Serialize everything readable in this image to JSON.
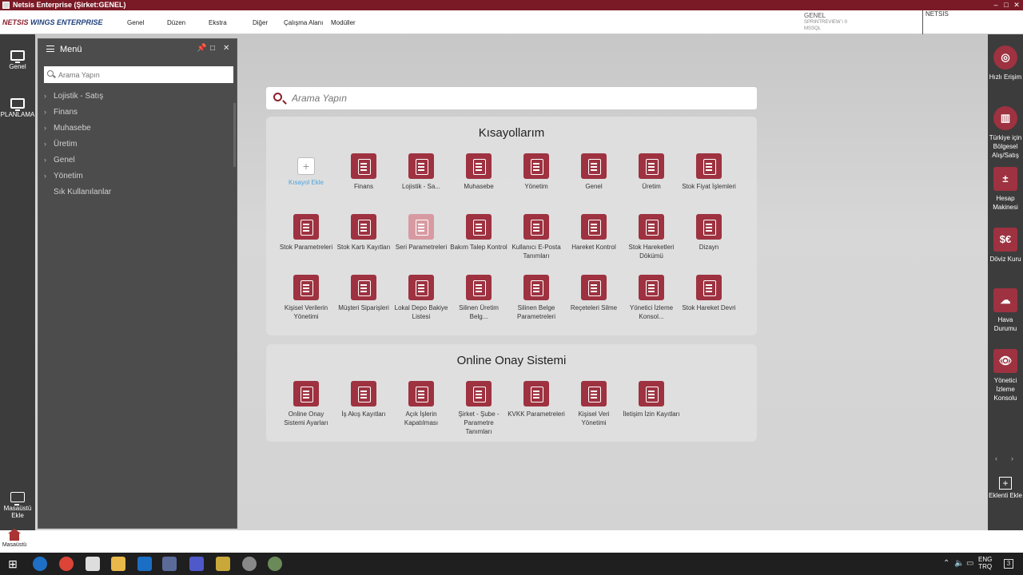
{
  "window": {
    "title": "Netsis Enterprise (Şirket:GENEL)",
    "controls": [
      "–",
      "□",
      "✕"
    ]
  },
  "logo": {
    "prefix": "NETSIS",
    "suffix": "WINGS ENTERPRISE"
  },
  "menubar": [
    "Genel",
    "Düzen",
    "Ekstra",
    "Diğer",
    "Çalışma Alanı",
    "Modüller"
  ],
  "info": {
    "company": "GENEL",
    "line2": "SPRINTREVIEW \\ 0",
    "line3": "MSSQL",
    "product": "NETSIS"
  },
  "left_rail": [
    "Genel",
    "PLANLAMA"
  ],
  "add_desktop": "Masaüstü Ekle",
  "menu_panel": {
    "title": "Menü",
    "search_placeholder": "Arama Yapın",
    "items": [
      "Lojistik - Satış",
      "Finans",
      "Muhasebe",
      "Üretim",
      "Genel",
      "Yönetim",
      "Sık Kullanılanlar"
    ]
  },
  "main_search": {
    "placeholder": "Arama Yapın"
  },
  "shortcuts": {
    "title": "Kısayollarım",
    "add_label": "Kısayol Ekle",
    "items": [
      "Finans",
      "Lojistik - Sa...",
      "Muhasebe",
      "Yönetim",
      "Genel",
      "Üretim",
      "Stok Fiyat İşlemleri",
      "Stok Parametreleri",
      "Stok Kartı Kayıtları",
      "Seri Parametreleri",
      "Bakım Talep Kontrol",
      "Kullanıcı E-Posta Tanımları",
      "Hareket Kontrol",
      "Stok Hareketleri Dökümü",
      "Dizayn",
      "Kişisel Verilerin Yönetimi",
      "Müşteri Siparişleri",
      "Lokal Depo Bakiye Listesi",
      "Silinen Üretim Belg...",
      "Silinen Belge Parametreleri",
      "Reçeteleri Silme",
      "Yönetici İzleme Konsol...",
      "Stok Hareket Devri"
    ]
  },
  "online_approval": {
    "title": "Online Onay Sistemi",
    "items": [
      "Online Onay Sistemi Ayarları",
      "İş Akış Kayıtları",
      "Açık İşlerin Kapatılması",
      "Şirket - Şube - Parametre Tanımları",
      "KVKK Parametreleri",
      "Kişisel Veri Yönetimi",
      "İletişim İzin Kayıtları"
    ]
  },
  "right_rail": [
    {
      "label": "Hızlı Erişim",
      "icon": "target-icon"
    },
    {
      "label": "Türkiye için Bölgesel Alış/Satış",
      "icon": "bar-chart-icon"
    },
    {
      "label": "Hesap Makinesi",
      "icon": "calculator-icon"
    },
    {
      "label": "Döviz Kuru",
      "icon": "currency-icon"
    },
    {
      "label": "Hava Durumu",
      "icon": "cloud-icon"
    },
    {
      "label": "Yönetici İzleme Konsolu",
      "icon": "eye-icon"
    }
  ],
  "add_widget": "Eklenti Ekle",
  "home": "Masaüstü",
  "taskbar": {
    "lang1": "ENG",
    "lang2": "TRQ",
    "notif": "3"
  },
  "colors": {
    "accent": "#9e3240",
    "titlebar": "#7a1a26",
    "rail": "#3c3c3c"
  }
}
